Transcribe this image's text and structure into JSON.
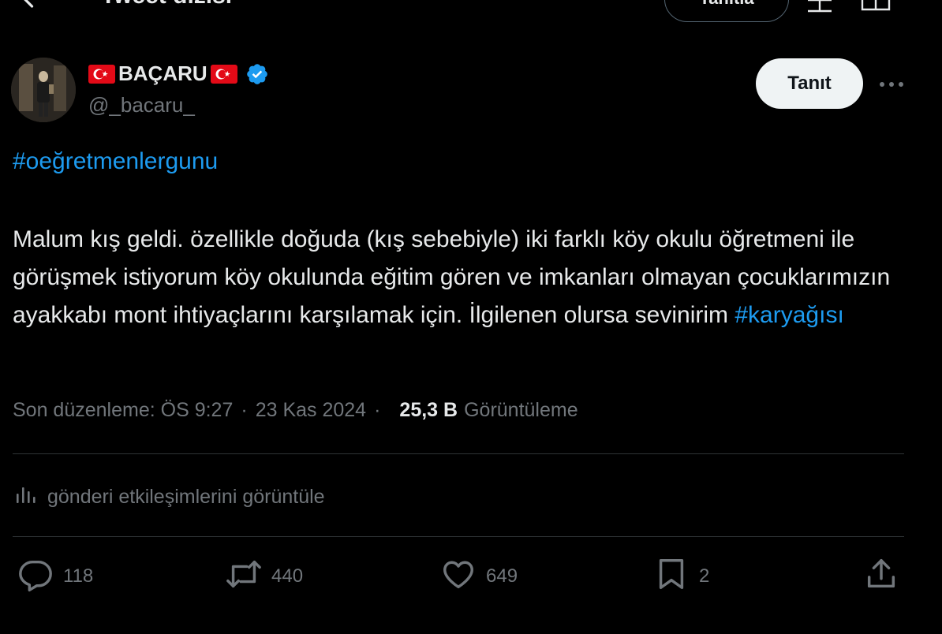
{
  "header": {
    "title": "Tweet dizisi",
    "translate_label": "Tanıtla"
  },
  "author": {
    "name": "BAÇARU",
    "handle": "@_bacaru_",
    "verified": true
  },
  "follow_label": "Tanıt",
  "tweet": {
    "hashtag_top": "#oeğretmenlergunu",
    "text": "Malum kış geldi. özellikle doğuda (kış sebebiyle) iki farklı köy okulu öğretmeni ile görüşmek istiyorum köy  okulunda eğitim gören ve imkanları olmayan çocuklarımızın ayakkabı mont ihtiyaçlarını karşılamak için. İlgilenen olursa sevinirim ",
    "hashtag_end": "#karyağısı"
  },
  "meta": {
    "edited": "Son düzenleme: ÖS 9:27",
    "separator": "·",
    "date": "23 Kas 2024",
    "views_count": "25,3 B",
    "views_label": "Görüntüleme"
  },
  "analytics_label": "gönderi etkileşimlerini görüntüle",
  "actions": {
    "replies": "118",
    "retweets": "440",
    "likes": "649",
    "bookmarks": "2"
  },
  "colors": {
    "background": "#000000",
    "text": "#e7e9ea",
    "muted": "#71767b",
    "accent": "#1d9bf0",
    "divider": "#2f3336",
    "flag_red": "#e30a17"
  },
  "icons": [
    "back-arrow-icon",
    "layout-icon",
    "book-icon",
    "flag-icon",
    "verified-badge-icon",
    "more-icon",
    "analytics-icon",
    "reply-icon",
    "retweet-icon",
    "like-icon",
    "bookmark-icon",
    "share-icon"
  ]
}
